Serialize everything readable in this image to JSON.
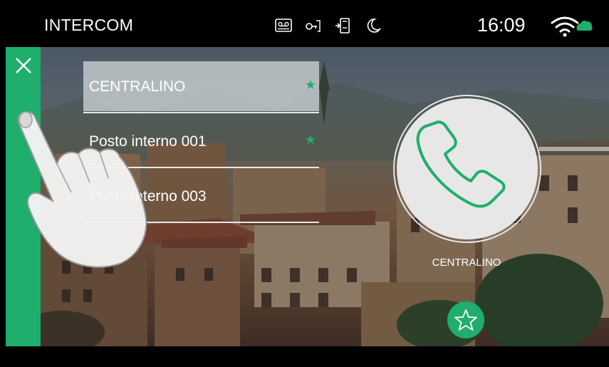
{
  "header": {
    "title": "INTERCOM",
    "status_icons": [
      "answering-machine-icon",
      "door-key-icon",
      "door-phone-icon",
      "night-mode-icon"
    ],
    "time": "16:09",
    "wifi": "wifi-cloud-icon"
  },
  "sidebar": {
    "close_icon": "close-icon",
    "color": "#1fae6c"
  },
  "contacts": [
    {
      "label": "CENTRALINO",
      "favorite": true,
      "selected": true
    },
    {
      "label": "Posto interno 001",
      "favorite": true,
      "selected": false
    },
    {
      "label": "Posto interno 003",
      "favorite": false,
      "selected": false
    }
  ],
  "call": {
    "label": "CENTRALINO",
    "icon": "phone-handset-icon"
  },
  "favorite_button": {
    "icon": "star-outline-icon"
  },
  "colors": {
    "accent": "#1fae6c",
    "top_bar": "#000000"
  }
}
